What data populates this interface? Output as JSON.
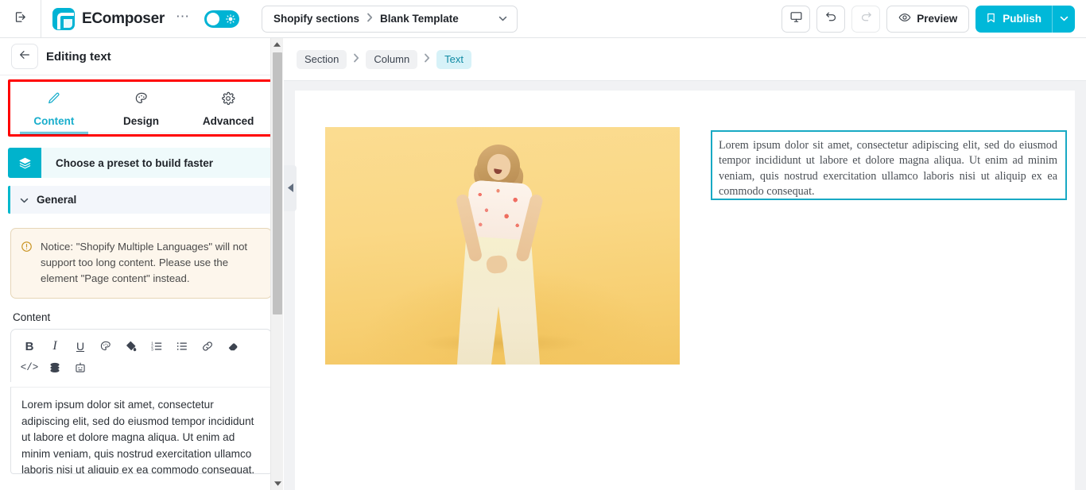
{
  "topbar": {
    "exit_icon": "exit-icon",
    "brand": "EComposer",
    "more_icon": "more-dots-icon",
    "theme_toggle": {
      "name": "theme-toggle",
      "state": "on",
      "icon": "sun-icon"
    },
    "breadcrumb": {
      "root": "Shopify sections",
      "separator": "›",
      "current": "Blank Template",
      "caret": "⌄"
    },
    "device_icon": "desktop-icon",
    "undo_icon": "undo-icon",
    "redo_icon": "redo-icon",
    "preview_label": "Preview",
    "preview_icon": "eye-icon",
    "publish_label": "Publish",
    "publish_icon": "bookmark-icon",
    "publish_caret": "⌄"
  },
  "sidebar": {
    "back_icon": "arrow-left-icon",
    "title": "Editing text",
    "tabs": [
      {
        "label": "Content",
        "icon": "pencil-icon",
        "active": true
      },
      {
        "label": "Design",
        "icon": "palette-icon",
        "active": false
      },
      {
        "label": "Advanced",
        "icon": "gear-icon",
        "active": false
      }
    ],
    "preset": {
      "label": "Choose a preset to build faster",
      "icon": "layers-icon"
    },
    "general": {
      "label": "General",
      "caret": "⌄"
    },
    "notice": {
      "icon": "warning-circle-icon",
      "text": "Notice: \"Shopify Multiple Languages\" will not support too long content. Please use the element \"Page content\" instead."
    },
    "content_label": "Content",
    "editor_toolbar": {
      "row1": [
        {
          "name": "bold-icon",
          "glyph": "B"
        },
        {
          "name": "italic-icon",
          "glyph": "I"
        },
        {
          "name": "underline-icon",
          "glyph": "U"
        },
        {
          "name": "text-color-palette-icon",
          "glyph": "◑"
        },
        {
          "name": "highlight-fill-icon",
          "glyph": "◆"
        },
        {
          "name": "ordered-list-icon",
          "glyph": "☰"
        },
        {
          "name": "bullet-list-icon",
          "glyph": "☰"
        },
        {
          "name": "link-icon",
          "glyph": "⚭"
        },
        {
          "name": "clear-format-eraser-icon",
          "glyph": "◆"
        }
      ],
      "row2": [
        {
          "name": "html-code-icon",
          "glyph": "</>"
        },
        {
          "name": "dynamic-source-icon",
          "glyph": "≡"
        },
        {
          "name": "ai-robot-icon",
          "glyph": "⌸"
        }
      ]
    },
    "editor_value": "Lorem ipsum dolor sit amet, consectetur adipiscing elit, sed do eiusmod tempor incididunt ut labore et dolore magna aliqua. Ut enim ad minim veniam, quis nostrud exercitation ullamco laboris nisi ut aliquip ex ea commodo consequat.",
    "scrollbar": {
      "up": "▲",
      "down": "▼"
    }
  },
  "canvas": {
    "breadcrumb": [
      {
        "label": "Section",
        "active": false
      },
      {
        "label": "Column",
        "active": false
      },
      {
        "label": "Text",
        "active": true
      }
    ],
    "separator": "›",
    "collapse_tab_icon": "chevron-left-icon",
    "image_alt": "woman-in-floral-top-yellow-background-photo",
    "text_block": "Lorem ipsum dolor sit amet, consectetur adipiscing elit, sed do eiusmod tempor incididunt ut labore et dolore magna aliqua. Ut enim ad minim veniam, quis nostrud exercitation ullamco laboris nisi ut aliquip ex ea commodo consequat."
  },
  "colors": {
    "accent_cyan": "#00b8d9",
    "brand_teal": "#00b3d4",
    "annotation_red": "#ff0000",
    "selection_teal": "#18a9c4",
    "notice_bg": "#fdf6ec"
  }
}
